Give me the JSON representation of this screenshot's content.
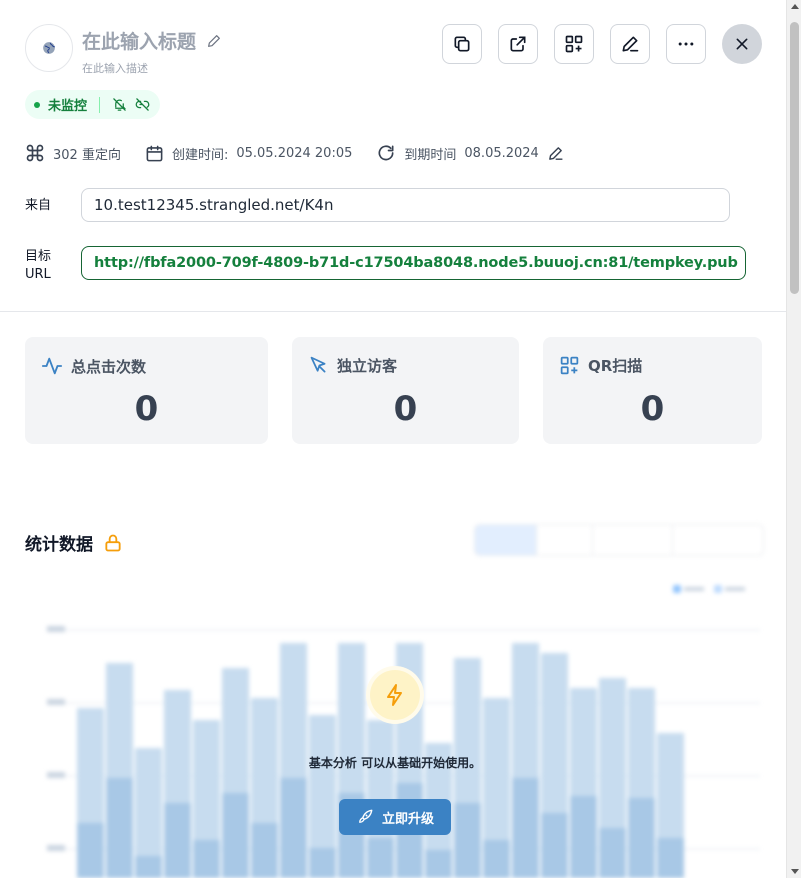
{
  "header": {
    "title": "在此输入标题",
    "description": "在此输入描述"
  },
  "status": {
    "label": "未监控"
  },
  "meta": {
    "redirect": "302 重定向",
    "created_label": "创建时间:",
    "created_value": "05.05.2024 20:05",
    "expiry_label": "到期时间",
    "expiry_value": "08.05.2024"
  },
  "fields": {
    "source_label": "来自",
    "source_value": "10.test12345.strangled.net/K4n",
    "target_label_line1": "目标",
    "target_label_line2": "URL",
    "target_value": "http://fbfa2000-709f-4809-b71d-c17504ba8048.node5.buuoj.cn:81/tempkey.pub"
  },
  "stats": [
    {
      "label": "总点击次数",
      "value": "0"
    },
    {
      "label": "独立访客",
      "value": "0"
    },
    {
      "label": "QR扫描",
      "value": "0"
    }
  ],
  "section": {
    "title": "统计数据"
  },
  "upgrade": {
    "text": "基本分析 可以从基础开始使用。",
    "button": "立即升级"
  },
  "colors": {
    "accent": "#3b82c4",
    "success": "#15803d",
    "lock": "#f59e0b"
  }
}
